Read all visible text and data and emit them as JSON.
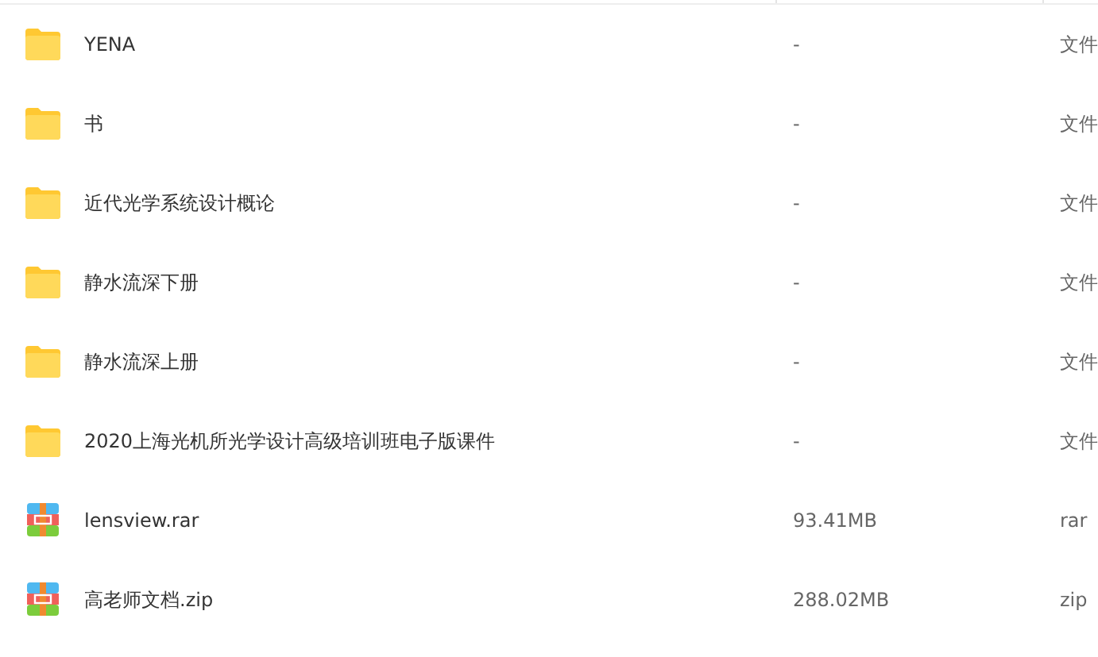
{
  "files": [
    {
      "kind": "folder",
      "name": "YENA",
      "size": "-",
      "type": "文件"
    },
    {
      "kind": "folder",
      "name": "书",
      "size": "-",
      "type": "文件"
    },
    {
      "kind": "folder",
      "name": "近代光学系统设计概论",
      "size": "-",
      "type": "文件"
    },
    {
      "kind": "folder",
      "name": "静水流深下册",
      "size": "-",
      "type": "文件"
    },
    {
      "kind": "folder",
      "name": "静水流深上册",
      "size": "-",
      "type": "文件"
    },
    {
      "kind": "folder",
      "name": "2020上海光机所光学设计高级培训班电子版课件",
      "size": "-",
      "type": "文件"
    },
    {
      "kind": "archive",
      "name": "lensview.rar",
      "size": "93.41MB",
      "type": "rar"
    },
    {
      "kind": "archive",
      "name": "高老师文档.zip",
      "size": "288.02MB",
      "type": "zip"
    }
  ]
}
